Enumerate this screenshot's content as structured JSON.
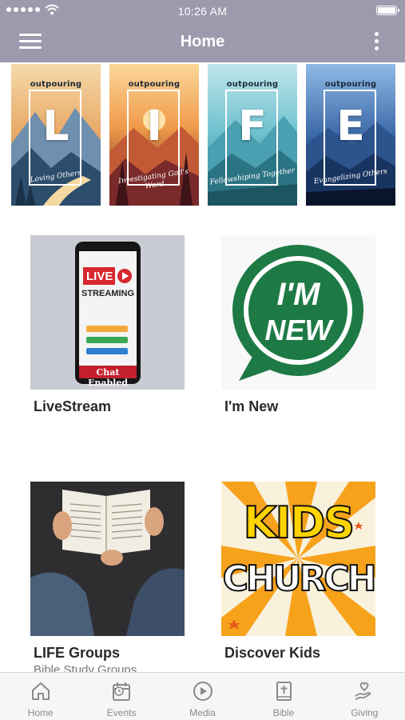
{
  "status_bar": {
    "time": "10:26 AM"
  },
  "nav": {
    "title": "Home",
    "menu_icon": "hamburger-menu-icon",
    "more_icon": "more-vertical-icon"
  },
  "banner": {
    "brand": "outpouring",
    "panels": [
      {
        "letter": "L",
        "tagline": "Loving Others",
        "colors": [
          "#1f4e73",
          "#e7a45a"
        ]
      },
      {
        "letter": "I",
        "tagline": "Investigating God's Word",
        "colors": [
          "#f0a050",
          "#6b2a2a"
        ]
      },
      {
        "letter": "F",
        "tagline": "Fellowshiping Together",
        "colors": [
          "#56b5c9",
          "#2c6f7c"
        ]
      },
      {
        "letter": "E",
        "tagline": "Evangelizing Others",
        "colors": [
          "#2a4a7a",
          "#0d1e3a"
        ]
      }
    ]
  },
  "tiles": [
    {
      "label": "LiveStream",
      "image_text": [
        "LIVE",
        "STREAMING",
        "Chat Enabled"
      ]
    },
    {
      "label": "I'm New",
      "image_text": [
        "I'M",
        "NEW"
      ],
      "accent": "#1e7a45"
    },
    {
      "label": "LIFE Groups",
      "subtitle": "Bible Study Groups"
    },
    {
      "label": "Discover Kids",
      "image_text": [
        "KIDS",
        "CHURCH"
      ]
    }
  ],
  "tabbar": [
    {
      "label": "Home",
      "icon": "home-icon"
    },
    {
      "label": "Events",
      "icon": "calendar-icon"
    },
    {
      "label": "Media",
      "icon": "play-circle-icon"
    },
    {
      "label": "Bible",
      "icon": "bible-icon"
    },
    {
      "label": "Giving",
      "icon": "hand-heart-icon"
    }
  ],
  "colors": {
    "header": "#9e9aae",
    "tab_icon": "#8a8a8a"
  }
}
